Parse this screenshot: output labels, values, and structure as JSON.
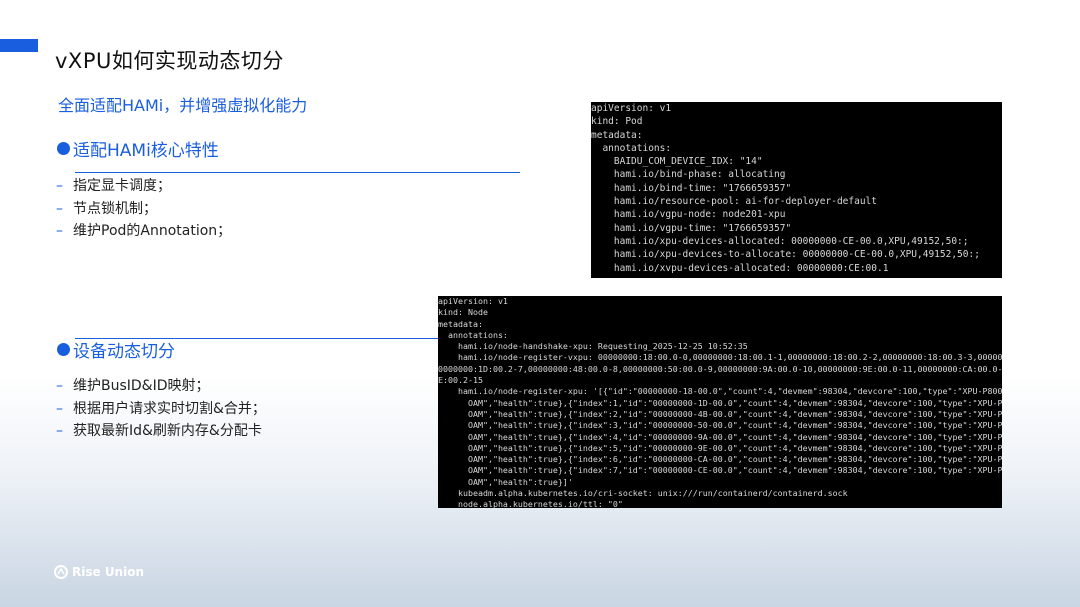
{
  "slide": {
    "title": "vXPU如何实现动态切分",
    "subtitle": "全面适配HAMi，并增强虚拟化能力"
  },
  "section1": {
    "heading": "适配HAMi核心特性",
    "bullets": [
      "指定显卡调度；",
      "节点锁机制；",
      "维护Pod的Annotation；"
    ]
  },
  "section2": {
    "heading": "设备动态切分",
    "bullets": [
      "维护BusID&ID映射；",
      "根据用户请求实时切割&合并；",
      "获取最新Id&刷新内存&分配卡"
    ]
  },
  "terminal_pod": {
    "lines": [
      "apiVersion: v1",
      "kind: Pod",
      "metadata:",
      "  annotations:",
      "    BAIDU_COM_DEVICE_IDX: \"14\"",
      "    hami.io/bind-phase: allocating",
      "    hami.io/bind-time: \"1766659357\"",
      "    hami.io/resource-pool: ai-for-deployer-default",
      "    hami.io/vgpu-node: node201-xpu",
      "    hami.io/vgpu-time: \"1766659357\"",
      "    hami.io/xpu-devices-allocated: 00000000-CE-00.0,XPU,49152,50:;",
      "    hami.io/xpu-devices-to-allocate: 00000000-CE-00.0,XPU,49152,50:;",
      "    hami.io/xvpu-devices-allocated: 00000000:CE:00.1"
    ]
  },
  "terminal_node": {
    "lines": [
      "apiVersion: v1",
      "kind: Node",
      "metadata:",
      "  annotations:",
      "    hami.io/node-handshake-xpu: Requesting_2025-12-25 10:52:35",
      "    hami.io/node-register-vxpu: 00000000:18:00.0-0,00000000:18:00.1-1,00000000:18:00.2-2,00000000:18:00.3-3,00000000",
      "0000000:1D:00.2-7,00000000:48:00.0-8,00000000:50:00.0-9,00000000:9A:00.0-10,00000000:9E:00.0-11,00000000:CA:00.0-12,0",
      "E:00.2-15",
      "    hami.io/node-register-xpu: '[{\"id\":\"00000000-18-00.0\",\"count\":4,\"devmem\":98304,\"devcore\":100,\"type\":\"XPU-P800",
      "      OAM\",\"health\":true},{\"index\":1,\"id\":\"00000000-1D-00.0\",\"count\":4,\"devmem\":98304,\"devcore\":100,\"type\":\"XPU-P800",
      "      OAM\",\"health\":true},{\"index\":2,\"id\":\"00000000-4B-00.0\",\"count\":4,\"devmem\":98304,\"devcore\":100,\"type\":\"XPU-P800",
      "      OAM\",\"health\":true},{\"index\":3,\"id\":\"00000000-50-00.0\",\"count\":4,\"devmem\":98304,\"devcore\":100,\"type\":\"XPU-P800",
      "      OAM\",\"health\":true},{\"index\":4,\"id\":\"00000000-9A-00.0\",\"count\":4,\"devmem\":98304,\"devcore\":100,\"type\":\"XPU-P800",
      "      OAM\",\"health\":true},{\"index\":5,\"id\":\"00000000-9E-00.0\",\"count\":4,\"devmem\":98304,\"devcore\":100,\"type\":\"XPU-P800",
      "      OAM\",\"health\":true},{\"index\":6,\"id\":\"00000000-CA-00.0\",\"count\":4,\"devmem\":98304,\"devcore\":100,\"type\":\"XPU-P800",
      "      OAM\",\"health\":true},{\"index\":7,\"id\":\"00000000-CE-00.0\",\"count\":4,\"devmem\":98304,\"devcore\":100,\"type\":\"XPU-P800",
      "      OAM\",\"health\":true}]'",
      "    kubeadm.alpha.kubernetes.io/cri-socket: unix:///run/containerd/containerd.sock",
      "    node.alpha.kubernetes.io/ttl: \"0\""
    ]
  },
  "footer": {
    "logo_text": "Rise Union"
  },
  "colors": {
    "accent": "#1a5ee0",
    "terminal_bg": "#000000",
    "terminal_fg": "#d8d8d8"
  }
}
